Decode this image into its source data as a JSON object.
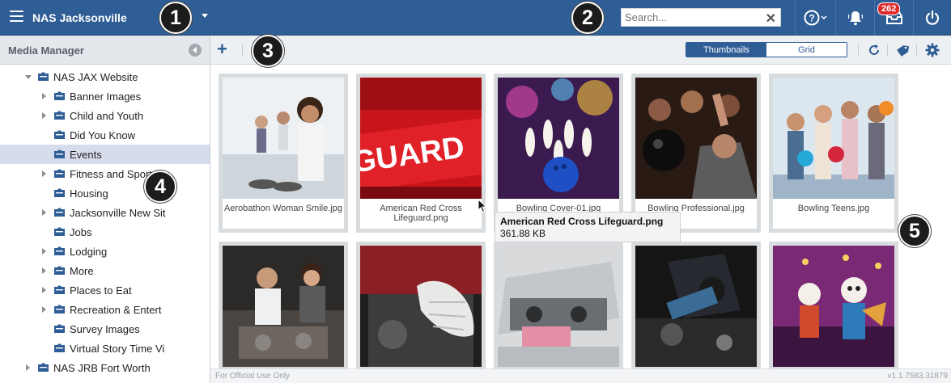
{
  "header": {
    "site_title": "NAS Jacksonville",
    "search_placeholder": "Search...",
    "notification_count": "262",
    "bg_color": "#2f5d95"
  },
  "callouts": [
    "1",
    "2",
    "3",
    "4",
    "5"
  ],
  "left_panel": {
    "title": "Media Manager",
    "tree": [
      {
        "label": "NAS JAX Website",
        "level": 0,
        "expander": "expanded"
      },
      {
        "label": "Banner Images",
        "level": 1,
        "expander": "collapsed"
      },
      {
        "label": "Child and Youth",
        "level": 1,
        "expander": "collapsed"
      },
      {
        "label": "Did You Know",
        "level": 1,
        "expander": "none"
      },
      {
        "label": "Events",
        "level": 1,
        "expander": "none",
        "selected": true
      },
      {
        "label": "Fitness and Sport",
        "level": 1,
        "expander": "collapsed"
      },
      {
        "label": "Housing",
        "level": 1,
        "expander": "none"
      },
      {
        "label": "Jacksonville New Sit",
        "level": 1,
        "expander": "collapsed"
      },
      {
        "label": "Jobs",
        "level": 1,
        "expander": "none"
      },
      {
        "label": "Lodging",
        "level": 1,
        "expander": "collapsed"
      },
      {
        "label": "More",
        "level": 1,
        "expander": "collapsed"
      },
      {
        "label": "Places to Eat",
        "level": 1,
        "expander": "collapsed"
      },
      {
        "label": "Recreation & Entert",
        "level": 1,
        "expander": "collapsed"
      },
      {
        "label": "Survey Images",
        "level": 1,
        "expander": "none"
      },
      {
        "label": "Virtual Story Time Vi",
        "level": 1,
        "expander": "none"
      },
      {
        "label": "NAS JRB Fort Worth",
        "level": 0,
        "expander": "collapsed"
      }
    ]
  },
  "toolbar": {
    "view_thumbnails": "Thumbnails",
    "view_grid": "Grid",
    "active_view": "Thumbnails"
  },
  "media": [
    {
      "name": "Aerobathon Woman Smile.jpg",
      "icon": "fitness-photo"
    },
    {
      "name": "American Red Cross Lifeguard.png",
      "icon": "lifeguard-photo"
    },
    {
      "name": "Bowling Cover-01.jpg",
      "icon": "bowling-pins-photo"
    },
    {
      "name": "Bowling Professional.jpg",
      "icon": "bowler-photo"
    },
    {
      "name": "Bowling Teens.jpg",
      "icon": "teens-bowling-photo"
    },
    {
      "name": "",
      "icon": "mechanic-photo"
    },
    {
      "name": "",
      "icon": "engine-gloves-photo"
    },
    {
      "name": "",
      "icon": "car-hood-photo"
    },
    {
      "name": "",
      "icon": "engine-repair-photo"
    },
    {
      "name": "",
      "icon": "animated-skeleton-photo"
    }
  ],
  "tooltip": {
    "name": "American Red Cross Lifeguard.png",
    "size": "361.88 KB"
  },
  "footer": {
    "left_text": "For Official Use Only",
    "version": "v1.1.7583.31879"
  }
}
